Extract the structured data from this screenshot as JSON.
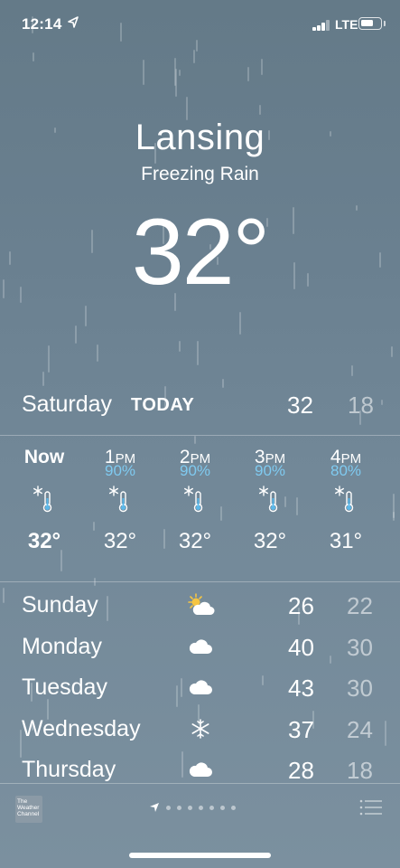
{
  "status_bar": {
    "time": "12:14",
    "network": "LTE"
  },
  "current": {
    "city": "Lansing",
    "condition": "Freezing Rain",
    "temperature": "32°"
  },
  "today": {
    "day": "Saturday",
    "label": "TODAY",
    "high": "32",
    "low": "18"
  },
  "hourly": [
    {
      "time": "Now",
      "suffix": "",
      "pop": "",
      "icon": "thermometer-snowflake-icon",
      "temp": "32°",
      "is_now": true
    },
    {
      "time": "1",
      "suffix": "PM",
      "pop": "90%",
      "icon": "thermometer-snowflake-icon",
      "temp": "32°"
    },
    {
      "time": "2",
      "suffix": "PM",
      "pop": "90%",
      "icon": "thermometer-snowflake-icon",
      "temp": "32°"
    },
    {
      "time": "3",
      "suffix": "PM",
      "pop": "90%",
      "icon": "thermometer-snowflake-icon",
      "temp": "32°"
    },
    {
      "time": "4",
      "suffix": "PM",
      "pop": "80%",
      "icon": "thermometer-snowflake-icon",
      "temp": "31°"
    }
  ],
  "daily": [
    {
      "day": "Sunday",
      "icon": "partly-sunny-icon",
      "high": "26",
      "low": "22"
    },
    {
      "day": "Monday",
      "icon": "cloud-icon",
      "high": "40",
      "low": "30"
    },
    {
      "day": "Tuesday",
      "icon": "cloud-icon",
      "high": "43",
      "low": "30"
    },
    {
      "day": "Wednesday",
      "icon": "snowflake-icon",
      "high": "37",
      "low": "24"
    },
    {
      "day": "Thursday",
      "icon": "cloud-icon",
      "high": "28",
      "low": "18"
    }
  ],
  "footer": {
    "logo_text": "The Weather Channel",
    "page_dots": 7
  },
  "colors": {
    "background_top": "#647a88",
    "background_bottom": "#7b909f",
    "precip_blue": "#7fcaf0"
  }
}
